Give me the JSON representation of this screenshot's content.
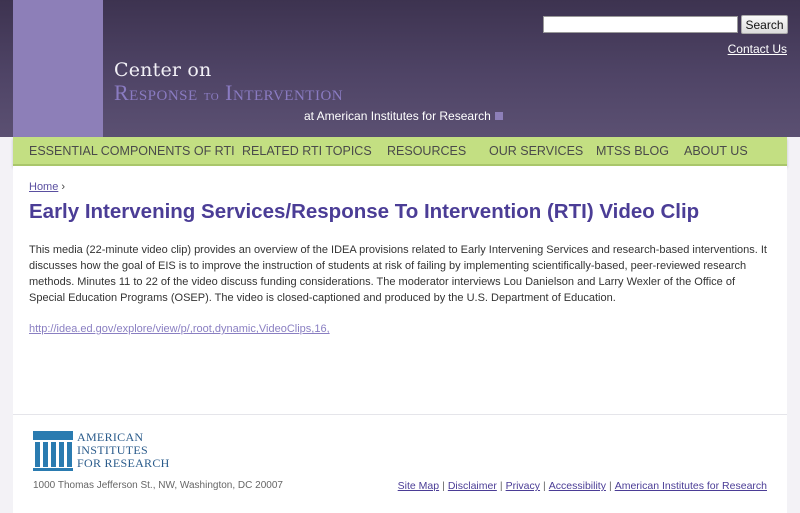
{
  "header": {
    "search": {
      "value": "",
      "placeholder": "",
      "button_label": "Search"
    },
    "contact_label": "Contact Us",
    "logo": {
      "line1": "Center on",
      "line2_a": "Response",
      "line2_b": "to",
      "line2_c": "Intervention",
      "line3": "at American Institutes for Research"
    }
  },
  "nav": {
    "items": [
      {
        "label": "ESSENTIAL COMPONENTS OF RTI"
      },
      {
        "label": "RELATED RTI TOPICS"
      },
      {
        "label": "RESOURCES"
      },
      {
        "label": "OUR SERVICES"
      },
      {
        "label": "MTSS BLOG"
      },
      {
        "label": "ABOUT US"
      }
    ]
  },
  "main": {
    "breadcrumb": {
      "home": "Home",
      "separator": "›"
    },
    "title": "Early Intervening Services/Response To Intervention (RTI) Video Clip",
    "description": "This media (22-minute video clip) provides an overview of the IDEA provisions related to Early Intervening Services and research-based interventions. It discusses how the goal of EIS is to improve the instruction of students at risk of failing by implementing scientifically-based, peer-reviewed research methods. Minutes 11 to 22 of the video discuss funding considerations. The moderator interviews Lou Danielson and Larry Wexler of the Office of Special Education Programs (OSEP). The video is closed-captioned and produced by the U.S. Department of Education.",
    "link": "http://idea.ed.gov/explore/view/p/,root,dynamic,VideoClips,16,"
  },
  "footer": {
    "logo_lines": [
      "American",
      "Institutes",
      "for Research"
    ],
    "address": "1000 Thomas Jefferson St., NW, Washington, DC 20007",
    "links": [
      "Site Map",
      "Disclaimer",
      "Privacy",
      "Accessibility",
      "American Institutes for Research"
    ],
    "separator": "|"
  },
  "colors": {
    "header_bg": "#4f4466",
    "accent_purple": "#8d7fb8",
    "nav_green": "#c3df82",
    "title_purple": "#4b3d96",
    "air_blue": "#2a5b8b"
  }
}
